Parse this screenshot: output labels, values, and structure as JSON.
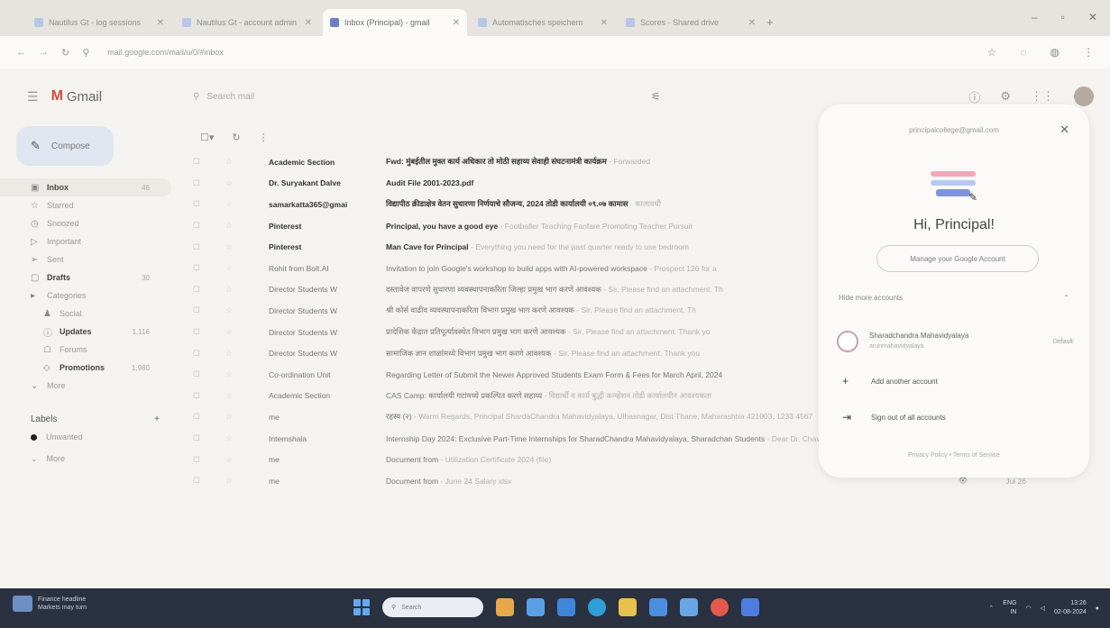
{
  "browser": {
    "tabs": [
      {
        "label": "Nautilus Gt - log sessions",
        "active": false
      },
      {
        "label": "Nautilus Gt - account admin",
        "active": false
      },
      {
        "label": "Inbox (Principal) - gmail",
        "active": true
      },
      {
        "label": "Automatisches speichern",
        "active": false
      },
      {
        "label": "Scores - Shared drive",
        "active": false
      }
    ],
    "url": "mail.google.com/mail/u/0/#inbox"
  },
  "gmail": {
    "logo_text": "Gmail",
    "search_placeholder": "Search mail",
    "compose_label": "Compose",
    "nav": [
      {
        "icon": "inbox",
        "label": "Inbox",
        "count": "46",
        "bold": true,
        "active": true
      },
      {
        "icon": "star",
        "label": "Starred",
        "count": "",
        "bold": false
      },
      {
        "icon": "clock",
        "label": "Snoozed",
        "count": "",
        "bold": false
      },
      {
        "icon": "important",
        "label": "Important",
        "count": "",
        "bold": false
      },
      {
        "icon": "send",
        "label": "Sent",
        "count": "",
        "bold": false
      },
      {
        "icon": "draft",
        "label": "Drafts",
        "count": "30",
        "bold": true
      },
      {
        "icon": "category",
        "label": "Categories",
        "count": "",
        "bold": false
      },
      {
        "icon": "social",
        "label": "Social",
        "count": "",
        "bold": false,
        "sub": true
      },
      {
        "icon": "updates",
        "label": "Updates",
        "count": "1,116",
        "bold": true,
        "sub": true
      },
      {
        "icon": "forums",
        "label": "Forums",
        "count": "",
        "bold": false,
        "sub": true
      },
      {
        "icon": "promotions",
        "label": "Promotions",
        "count": "1,980",
        "bold": true,
        "sub": true
      },
      {
        "icon": "more",
        "label": "More",
        "count": "",
        "bold": false
      }
    ],
    "labels_heading": "Labels",
    "labels": [
      {
        "label": "Unwanted",
        "color": "#222222"
      },
      {
        "label": "More",
        "color": ""
      }
    ],
    "emails": [
      {
        "sender": "Academic Section",
        "subject": "Fwd: मुंबईतील मुक्त कार्य अधिकार तो मोठी सहाय्य सेवाही संघटनामंत्री कार्यक्रम",
        "snippet": " - Forwarded",
        "unread": true,
        "date": ""
      },
      {
        "sender": "Dr. Suryakant Dalve",
        "subject": "Audit File 2001-2023.pdf",
        "snippet": "",
        "unread": true,
        "date": ""
      },
      {
        "sender": "samarkatta365@gmai",
        "subject": "विद्यापीठ क्रीडाक्षेत्र वेतन सुधारणा निर्णयाचे सौजन्य, 2024 तोडी कार्यालयी ०९.०७ कामास",
        "snippet": " - कालावधी",
        "unread": true,
        "date": ""
      },
      {
        "sender": "Pinterest",
        "subject": "Principal, you have a good eye",
        "snippet": " - Footballer Teaching Fanfare Promoting Teacher Pursuit",
        "unread": true,
        "date": ""
      },
      {
        "sender": "Pinterest",
        "subject": "Man Cave for Principal",
        "snippet": " - Everything you need for the past quarter ready to use bedroom",
        "unread": true,
        "date": ""
      },
      {
        "sender": "Rohit from Bolt.AI",
        "subject": "Invitation to join Google's workshop to build apps with AI-powered workspace",
        "snippet": " - Prospect 126 for a",
        "unread": false,
        "date": ""
      },
      {
        "sender": "Director Students W",
        "subject": "दस्तावेज वापरणे सुधारणा व्यवस्थापनाकरिता जिल्हा प्रमुख भाग करणे आवश्यक",
        "snippet": " - Sir, Please find an attachment. Th",
        "unread": false,
        "date": ""
      },
      {
        "sender": "Director Students W",
        "subject": "श्री कोर्स वाढीव व्यवस्थापनाकरिता विभाग प्रमुख भाग करणे आवश्यक",
        "snippet": " - Sir, Please find an attachment. Th",
        "unread": false,
        "date": ""
      },
      {
        "sender": "Director Students W",
        "subject": "प्रादेशिक केंद्रात प्रतिपूर्त्यावस्थेत विभाग प्रमुख भाग करणे आवश्यक",
        "snippet": " - Sir, Please find an attachment. Thank yo",
        "unread": false,
        "date": ""
      },
      {
        "sender": "Director Students W",
        "subject": "सामाजिक ज्ञान शाळांमध्ये विभाग प्रमुख भाग करणे आवश्यक",
        "snippet": " - Sir, Please find an attachment. Thank you",
        "unread": false,
        "date": ""
      },
      {
        "sender": "Co-ordination Unit",
        "subject": "Regarding Letter of Submit the Newer Approved Students Exam Form & Fees for March April, 2024",
        "snippet": "",
        "unread": false,
        "date": ""
      },
      {
        "sender": "Academic Section",
        "subject": "CAS Camp: कार्यालयी गटांमध्ये प्रकल्पित करणे सहाय्य",
        "snippet": " - विद्यार्थी व कार्य बुद्धी कन्व्हेंशन तोडी कार्यालयीन आवश्यकता",
        "unread": false,
        "date": ""
      },
      {
        "sender": "me",
        "subject": "रहस्य (२)",
        "snippet": " - Warm Regards, Principal ShardaChandra Mahavidyalaya, Ulhasnagar, Dist Thane, Maharashtra 421003, 1233 4567",
        "unread": false,
        "date": "Jul 26",
        "extra": "👁"
      },
      {
        "sender": "Internshala",
        "subject": "Internship Day 2024: Exclusive Part-Time Internships for SharadChandra Mahavidyalaya, Sharadchan Students",
        "snippet": " - Dear Dr. Chavan, Greetings",
        "unread": false,
        "date": "Jul 26"
      },
      {
        "sender": "me",
        "subject": "Document from",
        "snippet": " - Utilization Certificate 2024 (file)",
        "unread": false,
        "date": "Jul 26",
        "extra": "👁"
      },
      {
        "sender": "me",
        "subject": "Document from",
        "snippet": " - June 24 Salary xlsx",
        "unread": false,
        "date": "Jul 26",
        "extra": "👁"
      }
    ]
  },
  "account_panel": {
    "email": "principalcollege@gmail.com",
    "greeting": "Hi, Principal!",
    "manage_label": "Manage your Google Account",
    "hide_label": "Hide more accounts",
    "other_account_name": "Sharadchandra Mahavidyalaya",
    "other_account_email": "arunmahavidyalaya",
    "default_label": "Default",
    "add_account_label": "Add another account",
    "signout_label": "Sign out of all accounts",
    "footer": "Privacy Policy  •  Terms of Service"
  },
  "taskbar": {
    "weather_line1": "Finance headline",
    "weather_line2": "Markets may turn",
    "search_placeholder": "Search",
    "lang": "ENG",
    "lang_sub": "IN",
    "time": "13:26",
    "date": "02-08-2024"
  }
}
